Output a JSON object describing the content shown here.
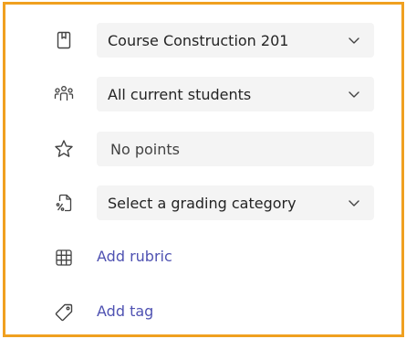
{
  "rows": {
    "class": {
      "value": "Course Construction 201",
      "icon": "notebook-icon"
    },
    "students": {
      "value": "All current students",
      "icon": "people-group-icon"
    },
    "points": {
      "placeholder": "No points",
      "icon": "star-icon"
    },
    "category": {
      "value": "Select a grading category",
      "icon": "grading-percent-icon"
    },
    "rubric": {
      "label": "Add rubric",
      "icon": "table-grid-icon"
    },
    "tag": {
      "label": "Add tag",
      "icon": "tag-icon"
    }
  },
  "colors": {
    "border_accent": "#f0a020",
    "link": "#4f52b2",
    "field_bg": "#f4f4f4"
  }
}
